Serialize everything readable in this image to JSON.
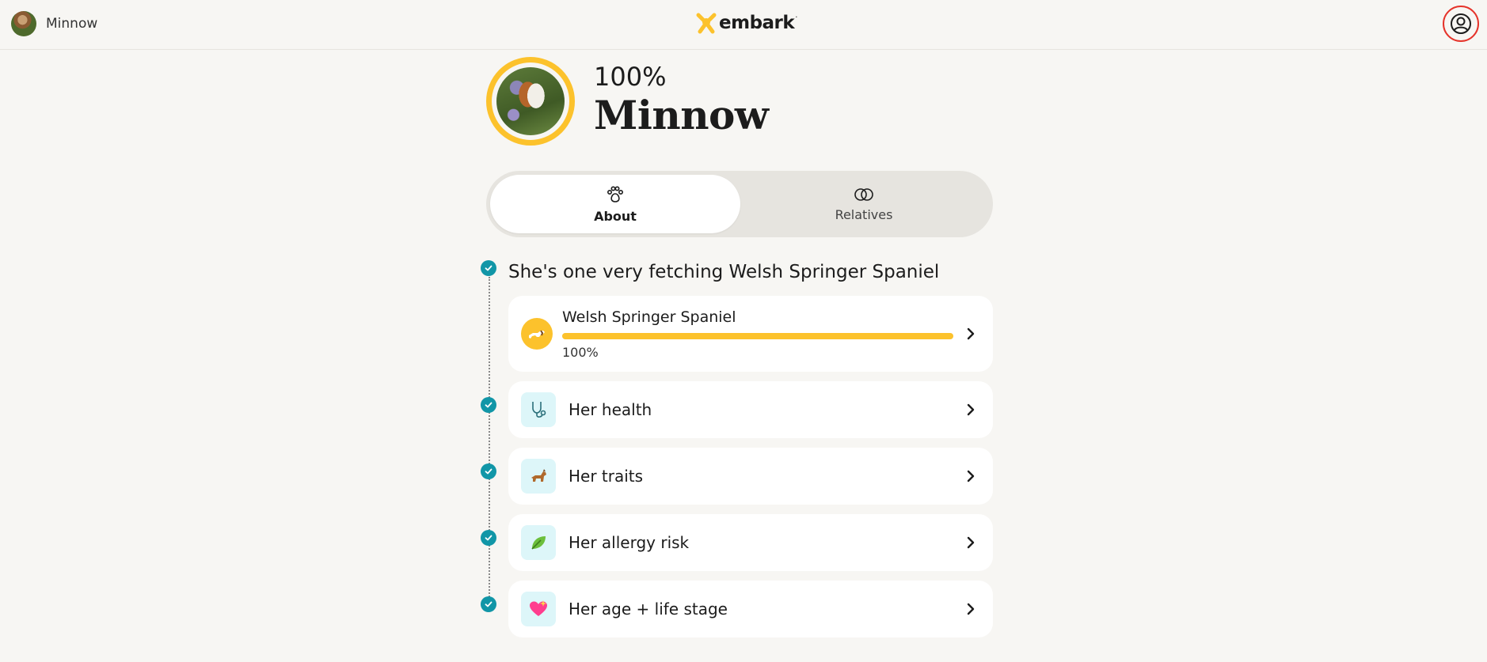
{
  "header": {
    "pet_name": "Minnow",
    "logo_text": "embark",
    "logo_mark": "·",
    "account_icon": "user-circle-icon"
  },
  "hero": {
    "percent": "100%",
    "name": "Minnow"
  },
  "tabs": [
    {
      "label": "About",
      "icon": "paw-icon",
      "selected": true
    },
    {
      "label": "Relatives",
      "icon": "linked-rings-icon",
      "selected": false
    }
  ],
  "timeline": {
    "intro": "She's one very fetching Welsh Springer Spaniel",
    "breed": {
      "name": "Welsh Springer Spaniel",
      "percent_label": "100%",
      "fraction": 1.0
    },
    "items": [
      {
        "label": "Her health",
        "icon": "stethoscope-icon"
      },
      {
        "label": "Her traits",
        "icon": "dog-icon"
      },
      {
        "label": "Her allergy risk",
        "icon": "leaf-icon"
      },
      {
        "label": "Her age + life stage",
        "icon": "heart-icon"
      }
    ]
  },
  "colors": {
    "accent_yellow": "#fcc22c",
    "check_teal": "#1196a7",
    "icon_bg": "#ddf6f9",
    "focus_red": "#e5332a"
  }
}
